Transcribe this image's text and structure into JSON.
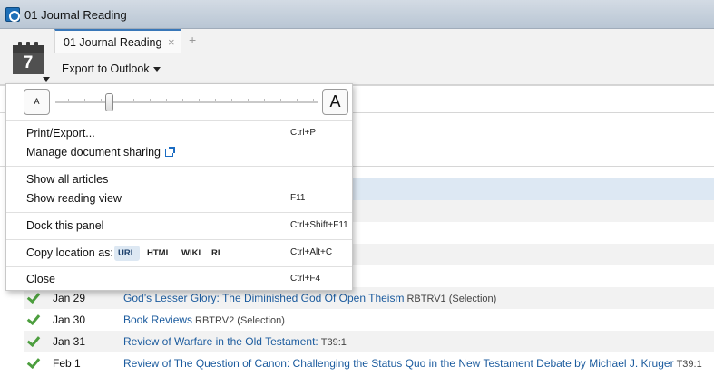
{
  "window": {
    "title": "01 Journal Reading",
    "app_icon": "logos-icon"
  },
  "panel": {
    "calendar_day": "7",
    "tab_label": "01 Journal Reading",
    "tab_close": "×",
    "tab_add": "+",
    "export_label": "Export to Outlook"
  },
  "menu": {
    "font_small_label": "A",
    "font_large_label": "A",
    "items": [
      {
        "label": "Print/Export...",
        "shortcut": "Ctrl+P"
      },
      {
        "label": "Manage document sharing",
        "shortcut": ""
      },
      {
        "label": "Show all articles",
        "shortcut": ""
      },
      {
        "label": "Show reading view",
        "shortcut": "F11"
      },
      {
        "label": "Dock this panel",
        "shortcut": "Ctrl+Shift+F11"
      },
      {
        "label": "Copy location as:",
        "shortcut": "Ctrl+Alt+C"
      },
      {
        "label": "Close",
        "shortcut": "Ctrl+F4"
      }
    ],
    "copy_options": [
      "URL",
      "HTML",
      "WIKI",
      "RL"
    ],
    "copy_selected": "URL"
  },
  "entries": [
    {
      "date": "Jan 29",
      "title": "God’s Lesser Glory: The Diminished God Of Open Theism",
      "source": "RBTRV1 (Selection)"
    },
    {
      "date": "Jan 30",
      "title": "Book Reviews",
      "source": "RBTRV2 (Selection)"
    },
    {
      "date": "Jan 31",
      "title": "Review of Warfare in the Old Testament:",
      "source": "T39:1"
    },
    {
      "date": "Feb 1",
      "title": "Review of The Question of Canon: Challenging the Status Quo in the New Testament Debate by Michael J. Kruger",
      "source": "T39:1"
    }
  ],
  "colors": {
    "link": "#1b5b9e",
    "check": "#4c9e3e",
    "selection": "#dde8f3",
    "tab_accent": "#3977b8"
  }
}
